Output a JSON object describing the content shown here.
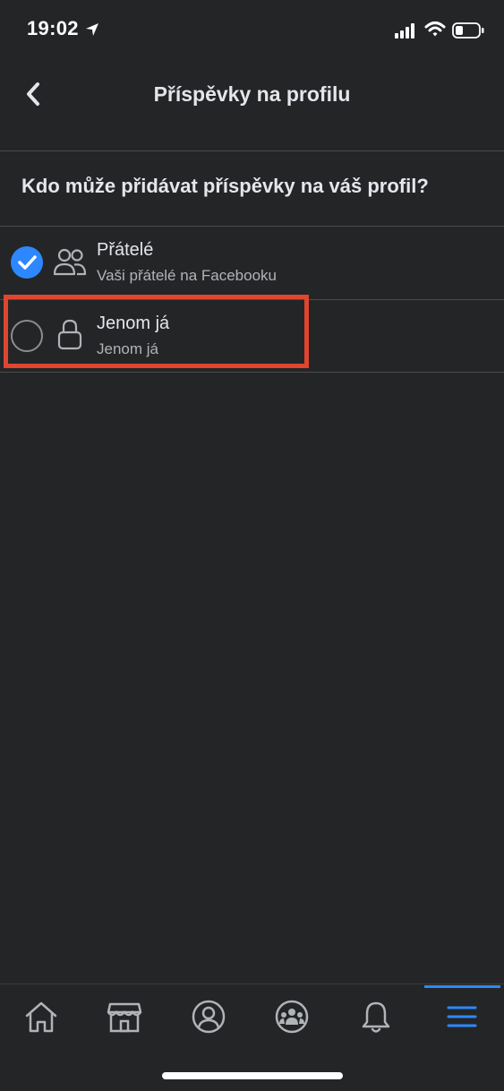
{
  "status_bar": {
    "time": "19:02",
    "icons": [
      "location-arrow-icon",
      "cellular-signal-icon",
      "wifi-icon",
      "battery-icon"
    ]
  },
  "nav": {
    "title": "Příspěvky na profilu",
    "back_icon": "chevron-left-icon"
  },
  "question": "Kdo může přidávat příspěvky na váš profil?",
  "options": [
    {
      "title": "Přátelé",
      "subtitle": "Vaši přátelé na Facebooku",
      "icon": "friends-icon",
      "selected": true
    },
    {
      "title": "Jenom já",
      "subtitle": "Jenom já",
      "icon": "lock-icon",
      "selected": false
    }
  ],
  "tab_bar": {
    "tabs": [
      "home-icon",
      "marketplace-icon",
      "profile-icon",
      "groups-icon",
      "notifications-icon",
      "menu-icon"
    ],
    "active": "menu-icon"
  },
  "colors": {
    "background": "#242527",
    "accent": "#2d88ff",
    "highlight": "#e0452f",
    "text_primary": "#e4e6eb",
    "text_secondary": "#b0b3b8"
  }
}
